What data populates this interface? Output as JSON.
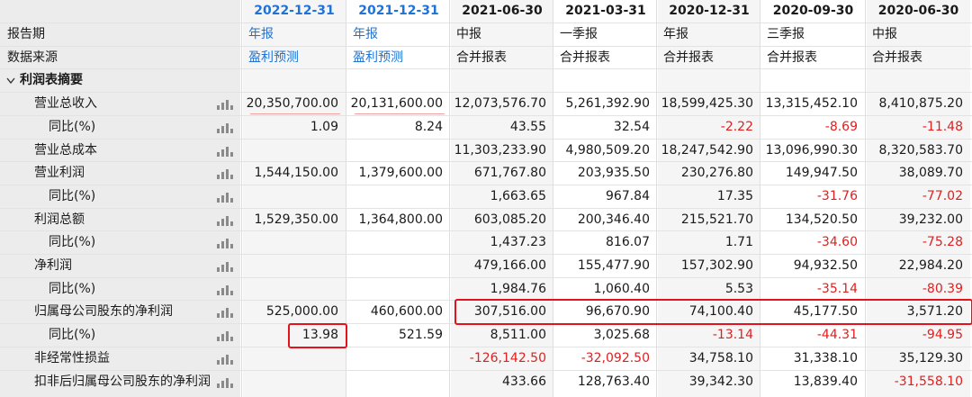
{
  "columns": [
    {
      "date": "2022-12-31",
      "forecast": true
    },
    {
      "date": "2021-12-31",
      "forecast": true
    },
    {
      "date": "2021-06-30",
      "forecast": false
    },
    {
      "date": "2021-03-31",
      "forecast": false
    },
    {
      "date": "2020-12-31",
      "forecast": false
    },
    {
      "date": "2020-09-30",
      "forecast": false
    },
    {
      "date": "2020-06-30",
      "forecast": false
    }
  ],
  "rows": [
    {
      "label": "报告期",
      "type": "meta",
      "values": [
        "年报",
        "年报",
        "中报",
        "一季报",
        "年报",
        "三季报",
        "中报"
      ],
      "styles": [
        "blue",
        "blue",
        "",
        "",
        "",
        "",
        ""
      ]
    },
    {
      "label": "数据来源",
      "type": "meta",
      "values": [
        "盈利预测",
        "盈利预测",
        "合并报表",
        "合并报表",
        "合并报表",
        "合并报表",
        "合并报表"
      ],
      "styles": [
        "blue",
        "blue",
        "",
        "",
        "",
        "",
        ""
      ]
    },
    {
      "label": "利润表摘要",
      "type": "section",
      "values": [
        "",
        "",
        "",
        "",
        "",
        "",
        ""
      ]
    },
    {
      "label": "营业总收入",
      "type": "item",
      "values": [
        "20,350,700.00",
        "20,131,600.00",
        "12,073,576.70",
        "5,261,392.90",
        "18,599,425.30",
        "13,315,452.10",
        "8,410,875.20"
      ]
    },
    {
      "label": "同比(%)",
      "type": "sub",
      "values": [
        "1.09",
        "8.24",
        "43.55",
        "32.54",
        "-2.22",
        "-8.69",
        "-11.48"
      ]
    },
    {
      "label": "营业总成本",
      "type": "item",
      "values": [
        "",
        "",
        "11,303,233.90",
        "4,980,509.20",
        "18,247,542.90",
        "13,096,990.30",
        "8,320,583.70"
      ]
    },
    {
      "label": "营业利润",
      "type": "item",
      "values": [
        "1,544,150.00",
        "1,379,600.00",
        "671,767.80",
        "203,935.50",
        "230,276.80",
        "149,947.50",
        "38,089.70"
      ]
    },
    {
      "label": "同比(%)",
      "type": "sub",
      "values": [
        "",
        "",
        "1,663.65",
        "967.84",
        "17.35",
        "-31.76",
        "-77.02"
      ]
    },
    {
      "label": "利润总额",
      "type": "item",
      "values": [
        "1,529,350.00",
        "1,364,800.00",
        "603,085.20",
        "200,346.40",
        "215,521.70",
        "134,520.50",
        "39,232.00"
      ]
    },
    {
      "label": "同比(%)",
      "type": "sub",
      "values": [
        "",
        "",
        "1,437.23",
        "816.07",
        "1.71",
        "-34.60",
        "-75.28"
      ]
    },
    {
      "label": "净利润",
      "type": "item",
      "values": [
        "",
        "",
        "479,166.00",
        "155,477.90",
        "157,302.90",
        "94,932.50",
        "22,984.20"
      ]
    },
    {
      "label": "同比(%)",
      "type": "sub",
      "values": [
        "",
        "",
        "1,984.76",
        "1,060.40",
        "5.53",
        "-35.14",
        "-80.39"
      ]
    },
    {
      "label": "归属母公司股东的净利润",
      "type": "item",
      "values": [
        "525,000.00",
        "460,600.00",
        "307,516.00",
        "96,670.90",
        "74,100.40",
        "45,177.50",
        "3,571.20"
      ]
    },
    {
      "label": "同比(%)",
      "type": "sub",
      "values": [
        "13.98",
        "521.59",
        "8,511.00",
        "3,025.68",
        "-13.14",
        "-44.31",
        "-94.95"
      ]
    },
    {
      "label": "非经常性损益",
      "type": "item",
      "values": [
        "",
        "",
        "-126,142.50",
        "-32,092.50",
        "34,758.10",
        "31,338.10",
        "35,129.30"
      ]
    },
    {
      "label": "扣非后归属母公司股东的净利润",
      "type": "item",
      "values": [
        "",
        "",
        "433.66",
        "128,763.40",
        "39,342.30",
        "13,839.40",
        "-31,558.10"
      ]
    }
  ],
  "icons": {
    "chart": "bar-chart-icon",
    "collapse": "chevron-down-icon"
  },
  "colors": {
    "forecast": "#1f73d6",
    "negative": "#e02020",
    "highlight": "#e3121b"
  }
}
